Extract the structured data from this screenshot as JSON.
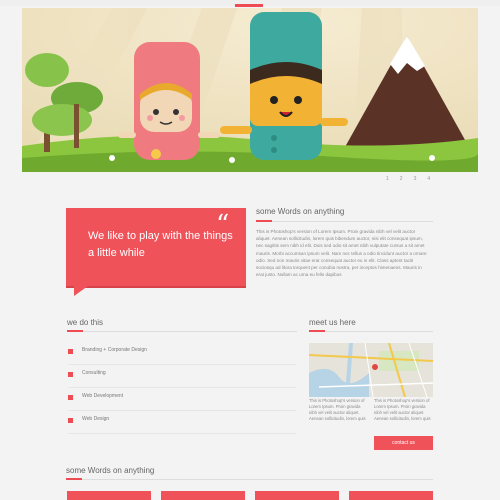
{
  "slider": {
    "pages": [
      "1",
      "2",
      "3",
      "4"
    ]
  },
  "quote": {
    "text": "We like to play with the things a little while",
    "mark": "“"
  },
  "about": {
    "title": "some Words on anything",
    "body": "This is Photoshop's version of Lorem Ipsum. Proin gravida nibh vel velit auctor aliquet. Aenean sollicitudin, lorem quis bibendum auctor, nisi elit consequat ipsum, nec sagittis sem nibh id elit. Duis sed odio sit amet nibh vulputate cursus a sit amet mauris. Morbi accumsan ipsum velit. Nam nec tellus a odio tincidunt auctor a ornare odio. Sed non mauris vitae erat consequat auctor eu in elit. Class aptent taciti sociosqu ad litora torquent per conubia nostra, per inceptos himenaeos. Mauris in erat justo. Nullam ac urna eu felis dapibus"
  },
  "services": {
    "title": "we do this",
    "items": [
      "Branding + Corporate Design",
      "Consulting",
      "Web Development",
      "Web Design"
    ]
  },
  "meet": {
    "title": "meet us here",
    "col1": "This is Photoshop's version of Lorem Ipsum. Proin gravida nibh vel velit auctor aliquet. Aenean sollicitudin, lorem quis",
    "col2": "This is Photoshop's version of Lorem Ipsum. Proin gravida nibh vel velit auctor aliquet. Aenean sollicitudin, lorem quis",
    "button": "contact us"
  },
  "footer_section": {
    "title": "some Words on anything"
  },
  "colors": {
    "accent": "#f0525a",
    "background": "#f3f3f3"
  }
}
